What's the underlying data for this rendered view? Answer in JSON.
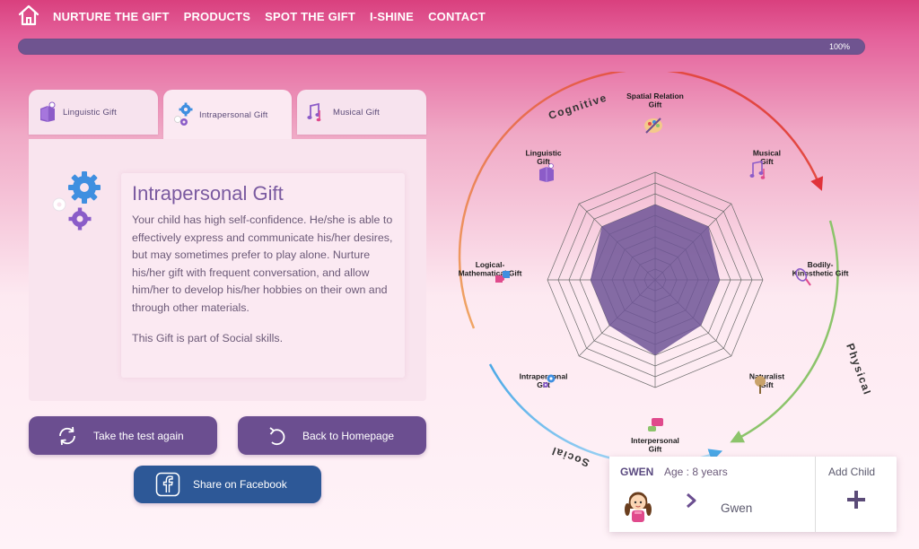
{
  "nav": {
    "links": [
      "NURTURE THE GIFT",
      "PRODUCTS",
      "SPOT THE GIFT",
      "I-SHINE",
      "CONTACT"
    ]
  },
  "progress": {
    "value": 1.0,
    "label": "100%"
  },
  "tabs": [
    {
      "label": "Linguistic Gift",
      "icon": "book-icon",
      "active": false
    },
    {
      "label": "Intrapersonal Gift",
      "icon": "gears-icon",
      "active": true
    },
    {
      "label": "Musical Gift",
      "icon": "music-notes-icon",
      "active": false
    }
  ],
  "detail": {
    "title": "Intrapersonal Gift",
    "body": "Your child has high self-confidence. He/she is able to effectively express and communicate his/her desires, but may sometimes prefer to play alone. Nurture his/her gift with frequent conversation, and allow him/her to develop his/her hobbies on their own and through other materials.",
    "note": "This Gift is part of Social skills."
  },
  "buttons": {
    "retake": "Take the test again",
    "home": "Back to Homepage",
    "share": "Share on Facebook"
  },
  "radar": {
    "arc_labels": {
      "cognitive": "Cognitive",
      "physical": "Physical",
      "social": "Social"
    },
    "axes": [
      {
        "label": "Spatial Relation\nGift",
        "icon": "palette-icon"
      },
      {
        "label": "Musical\nGift",
        "icon": "music-notes-icon"
      },
      {
        "label": "Bodily-\nKinesthetic Gift",
        "icon": "racket-icon"
      },
      {
        "label": "Naturalist\nGift",
        "icon": "tree-icon"
      },
      {
        "label": "Interpersonal\nGift",
        "icon": "chat-icon"
      },
      {
        "label": "Intrapersonal\nGift",
        "icon": "gears-icon"
      },
      {
        "label": "Logical-\nMathematical Gift",
        "icon": "puzzle-icon"
      },
      {
        "label": "Linguistic\nGift",
        "icon": "book-icon"
      }
    ],
    "levels": 10,
    "max": 10,
    "values": [
      7,
      7,
      6,
      6,
      7,
      6,
      6,
      7
    ],
    "colors": {
      "fill": "#6e5596",
      "grid": "#6a6a6a",
      "cognitive": "#e0503a",
      "physical": "#8cc46b",
      "social": "#4aa8e6"
    }
  },
  "child": {
    "name_top": "GWEN",
    "age": "Age : 8 years",
    "name": "Gwen",
    "add_label": "Add Child"
  }
}
